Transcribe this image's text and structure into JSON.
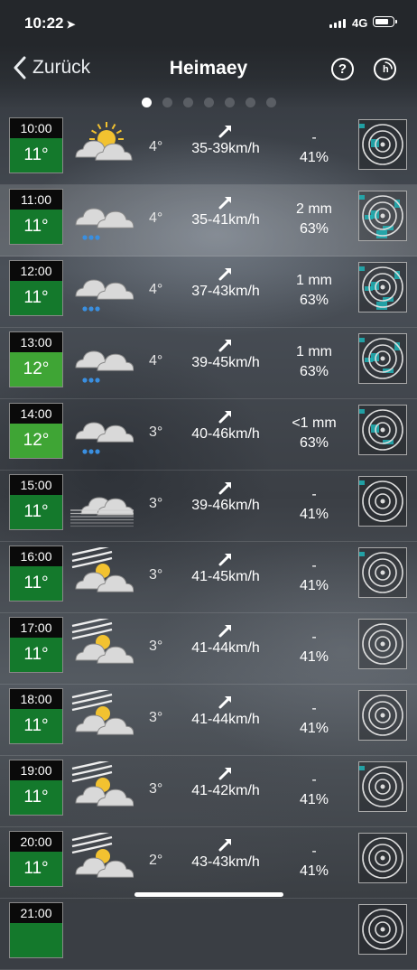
{
  "status_bar": {
    "time": "10:22",
    "network": "4G"
  },
  "nav": {
    "back_label": "Zurück",
    "title": "Heimaey",
    "help_label": "?"
  },
  "pager": {
    "count": 7,
    "active": 0
  },
  "colors": {
    "green_dark": "#14792c",
    "green_light": "#3fa535",
    "radar_cyan": "#1fb3b6"
  },
  "rows": [
    {
      "hour": "10:00",
      "temp": "11°",
      "temp_color": "#14792c",
      "icon": "partly-sunny-icon",
      "feels": "4°",
      "wind": "35-39km/h",
      "precip": "-",
      "humidity": "41%",
      "radar_level": 0.15
    },
    {
      "hour": "11:00",
      "temp": "11°",
      "temp_color": "#14792c",
      "icon": "rain-cloud-icon",
      "feels": "4°",
      "wind": "35-41km/h",
      "precip": "2 mm",
      "humidity": "63%",
      "radar_level": 0.6
    },
    {
      "hour": "12:00",
      "temp": "11°",
      "temp_color": "#14792c",
      "icon": "rain-cloud-icon",
      "feels": "4°",
      "wind": "37-43km/h",
      "precip": "1 mm",
      "humidity": "63%",
      "radar_level": 0.55
    },
    {
      "hour": "13:00",
      "temp": "12°",
      "temp_color": "#3fa535",
      "icon": "rain-cloud-icon",
      "feels": "4°",
      "wind": "39-45km/h",
      "precip": "1 mm",
      "humidity": "63%",
      "radar_level": 0.5
    },
    {
      "hour": "14:00",
      "temp": "12°",
      "temp_color": "#3fa535",
      "icon": "rain-cloud-icon",
      "feels": "3°",
      "wind": "40-46km/h",
      "precip": "<1 mm",
      "humidity": "63%",
      "radar_level": 0.3
    },
    {
      "hour": "15:00",
      "temp": "11°",
      "temp_color": "#14792c",
      "icon": "fog-cloud-icon",
      "feels": "3°",
      "wind": "39-46km/h",
      "precip": "-",
      "humidity": "41%",
      "radar_level": 0.05
    },
    {
      "hour": "16:00",
      "temp": "11°",
      "temp_color": "#14792c",
      "icon": "windy-sun-cloud-icon",
      "feels": "3°",
      "wind": "41-45km/h",
      "precip": "-",
      "humidity": "41%",
      "radar_level": 0.08
    },
    {
      "hour": "17:00",
      "temp": "11°",
      "temp_color": "#14792c",
      "icon": "windy-sun-cloud-icon",
      "feels": "3°",
      "wind": "41-44km/h",
      "precip": "-",
      "humidity": "41%",
      "radar_level": 0
    },
    {
      "hour": "18:00",
      "temp": "11°",
      "temp_color": "#14792c",
      "icon": "windy-sun-cloud-icon",
      "feels": "3°",
      "wind": "41-44km/h",
      "precip": "-",
      "humidity": "41%",
      "radar_level": 0
    },
    {
      "hour": "19:00",
      "temp": "11°",
      "temp_color": "#14792c",
      "icon": "windy-sun-cloud-icon",
      "feels": "3°",
      "wind": "41-42km/h",
      "precip": "-",
      "humidity": "41%",
      "radar_level": 0.05
    },
    {
      "hour": "20:00",
      "temp": "11°",
      "temp_color": "#14792c",
      "icon": "windy-sun-cloud-icon",
      "feels": "2°",
      "wind": "43-43km/h",
      "precip": "-",
      "humidity": "41%",
      "radar_level": 0
    },
    {
      "hour": "21:00",
      "temp": "",
      "temp_color": "#14792c",
      "icon": "",
      "feels": "",
      "wind": "",
      "precip": "",
      "humidity": "",
      "radar_level": 0
    }
  ]
}
